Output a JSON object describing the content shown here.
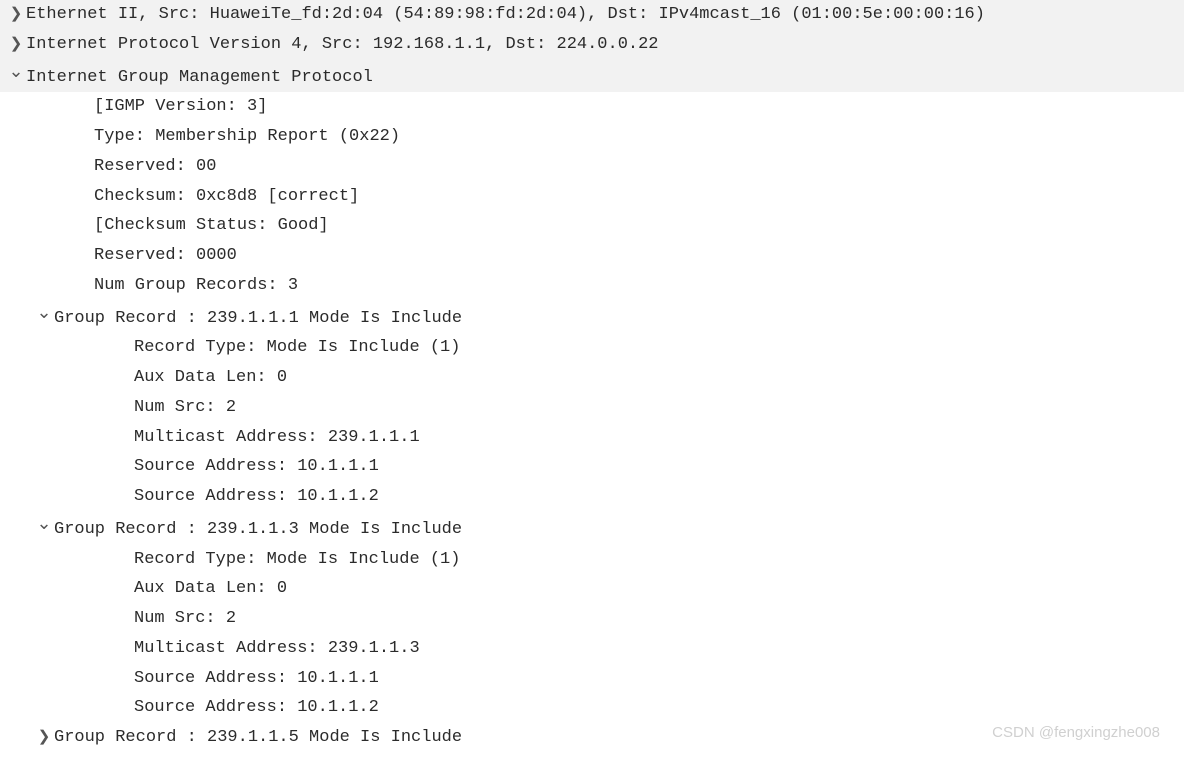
{
  "rows": [
    {
      "level": "top",
      "arrow": "right",
      "indent": "0",
      "text": "Ethernet II, Src: HuaweiTe_fd:2d:04 (54:89:98:fd:2d:04), Dst: IPv4mcast_16 (01:00:5e:00:00:16)"
    },
    {
      "level": "top",
      "arrow": "right",
      "indent": "0",
      "text": "Internet Protocol Version 4, Src: 192.168.1.1, Dst: 224.0.0.22"
    },
    {
      "level": "top",
      "arrow": "down",
      "indent": "0",
      "text": "Internet Group Management Protocol"
    },
    {
      "level": "sub",
      "arrow": "",
      "indent": "2",
      "text": "[IGMP Version: 3]"
    },
    {
      "level": "sub",
      "arrow": "",
      "indent": "2",
      "text": "Type: Membership Report (0x22)"
    },
    {
      "level": "sub",
      "arrow": "",
      "indent": "2",
      "text": "Reserved: 00"
    },
    {
      "level": "sub",
      "arrow": "",
      "indent": "2",
      "text": "Checksum: 0xc8d8 [correct]"
    },
    {
      "level": "sub",
      "arrow": "",
      "indent": "2",
      "text": "[Checksum Status: Good]"
    },
    {
      "level": "sub",
      "arrow": "",
      "indent": "2",
      "text": "Reserved: 0000"
    },
    {
      "level": "sub",
      "arrow": "",
      "indent": "2",
      "text": "Num Group Records: 3"
    },
    {
      "level": "sub",
      "arrow": "down",
      "indent": "1g",
      "text": "Group Record : 239.1.1.1  Mode Is Include"
    },
    {
      "level": "sub",
      "arrow": "",
      "indent": "3",
      "text": "Record Type: Mode Is Include (1)"
    },
    {
      "level": "sub",
      "arrow": "",
      "indent": "3",
      "text": "Aux Data Len: 0"
    },
    {
      "level": "sub",
      "arrow": "",
      "indent": "3",
      "text": "Num Src: 2"
    },
    {
      "level": "sub",
      "arrow": "",
      "indent": "3",
      "text": "Multicast Address: 239.1.1.1"
    },
    {
      "level": "sub",
      "arrow": "",
      "indent": "3",
      "text": "Source Address: 10.1.1.1"
    },
    {
      "level": "sub",
      "arrow": "",
      "indent": "3",
      "text": "Source Address: 10.1.1.2"
    },
    {
      "level": "sub",
      "arrow": "down",
      "indent": "1g",
      "text": "Group Record : 239.1.1.3  Mode Is Include"
    },
    {
      "level": "sub",
      "arrow": "",
      "indent": "3",
      "text": "Record Type: Mode Is Include (1)"
    },
    {
      "level": "sub",
      "arrow": "",
      "indent": "3",
      "text": "Aux Data Len: 0"
    },
    {
      "level": "sub",
      "arrow": "",
      "indent": "3",
      "text": "Num Src: 2"
    },
    {
      "level": "sub",
      "arrow": "",
      "indent": "3",
      "text": "Multicast Address: 239.1.1.3"
    },
    {
      "level": "sub",
      "arrow": "",
      "indent": "3",
      "text": "Source Address: 10.1.1.1"
    },
    {
      "level": "sub",
      "arrow": "",
      "indent": "3",
      "text": "Source Address: 10.1.1.2"
    },
    {
      "level": "sub",
      "arrow": "right",
      "indent": "1g",
      "text": "Group Record : 239.1.1.5  Mode Is Include"
    }
  ],
  "watermark": "CSDN @fengxingzhe008"
}
